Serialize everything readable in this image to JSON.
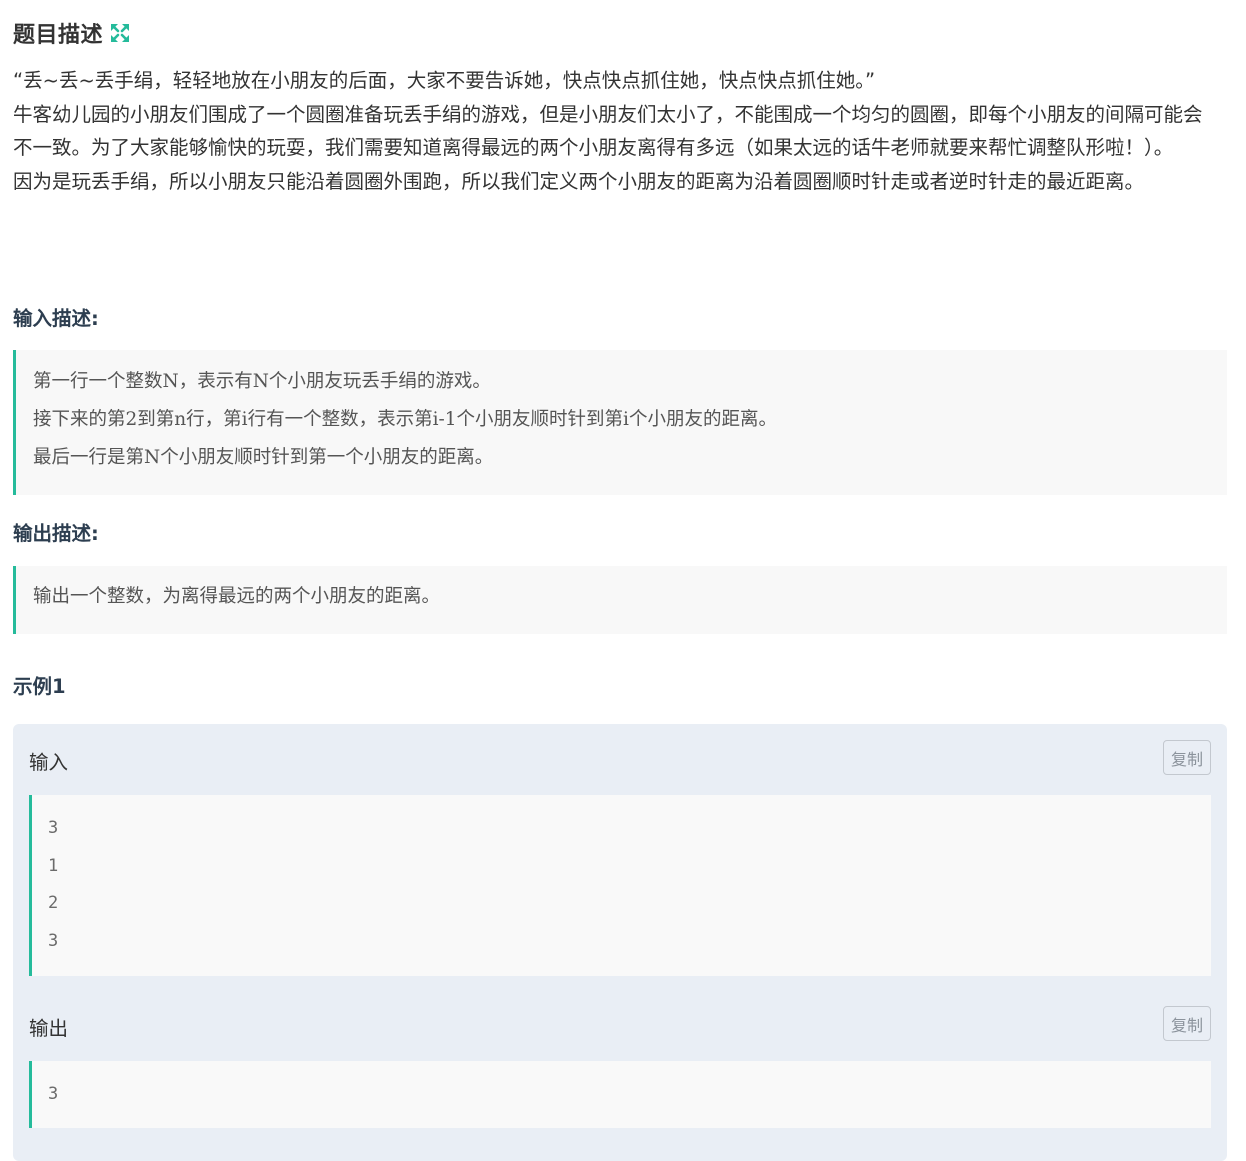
{
  "title": "题目描述",
  "icons": {
    "expand": "expand-icon"
  },
  "colors": {
    "accent": "#25bb9b",
    "example_bg": "#e9eef5",
    "quote_bg": "#f8f8f8"
  },
  "description": [
    "“丢~丢~丢手绢，轻轻地放在小朋友的后面，大家不要告诉她，快点快点抓住她，快点快点抓住她。”",
    "牛客幼儿园的小朋友们围成了一个圆圈准备玩丢手绢的游戏，但是小朋友们太小了，不能围成一个均匀的圆圈，即每个小朋友的间隔可能会不一致。为了大家能够愉快的玩耍，我们需要知道离得最远的两个小朋友离得有多远（如果太远的话牛老师就要来帮忙调整队形啦！）。",
    "因为是玩丢手绢，所以小朋友只能沿着圆圈外围跑，所以我们定义两个小朋友的距离为沿着圆圈顺时针走或者逆时针走的最近距离。"
  ],
  "input_section": {
    "label": "输入描述:",
    "lines": [
      "第一行一个整数N，表示有N个小朋友玩丢手绢的游戏。",
      "接下来的第2到第n行，第i行有一个整数，表示第i-1个小朋友顺时针到第i个小朋友的距离。",
      "最后一行是第N个小朋友顺时针到第一个小朋友的距离。"
    ]
  },
  "output_section": {
    "label": "输出描述:",
    "lines": [
      "输出一个整数，为离得最远的两个小朋友的距离。"
    ]
  },
  "example": {
    "label": "示例1",
    "input_label": "输入",
    "output_label": "输出",
    "copy_label": "复制",
    "input_lines": [
      "3",
      "1",
      "2",
      "3"
    ],
    "output_lines": [
      "3"
    ]
  }
}
